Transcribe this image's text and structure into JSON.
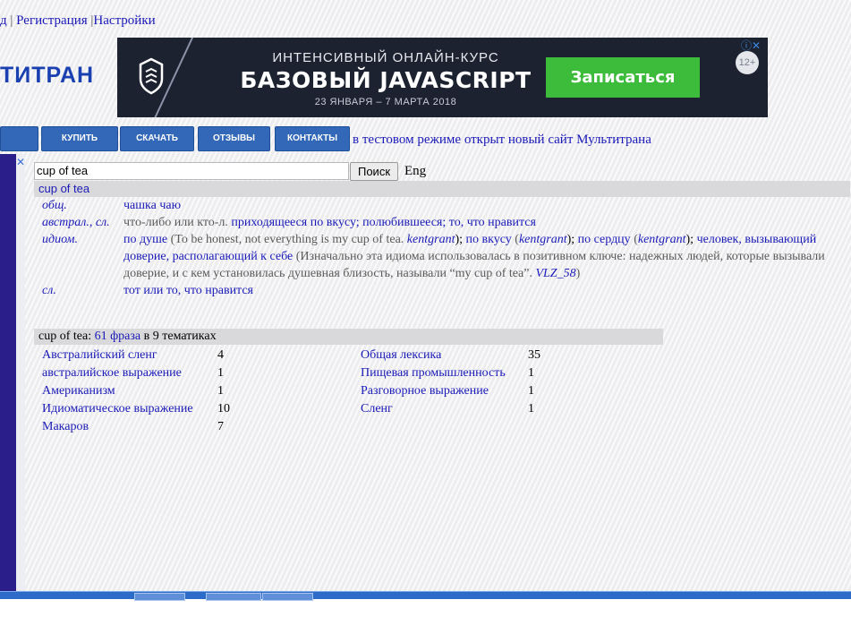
{
  "top_links": {
    "login_fragment": "д",
    "sep1": "|",
    "register": "Регистрация",
    "sep2": "|",
    "settings": "Настройки"
  },
  "logo": {
    "text": "ТИТРАН"
  },
  "banner": {
    "line1": "ИНТЕНСИВНЫЙ ОНЛАЙН-КУРС",
    "line2": "БАЗОВЫЙ JAVASCRIPT",
    "line3": "23 ЯНВАРЯ – 7 МАРТА 2018",
    "cta": "Записаться",
    "age": "12+",
    "adinfo": "ⓘ✕"
  },
  "nav": {
    "buttons": [
      "КУПИТЬ",
      "СКАЧАТЬ",
      "ОТЗЫВЫ",
      "КОНТАКТЫ"
    ],
    "notice": "в тестовом режиме открыт новый сайт Мультитрана"
  },
  "search": {
    "value": "cup of tea",
    "button": "Поиск",
    "lang": "Eng"
  },
  "term": {
    "header": "cup of tea",
    "entries": [
      {
        "subject": "общ.",
        "parts": [
          {
            "t": "чашка чаю",
            "k": "link"
          }
        ]
      },
      {
        "subject": "австрал., сл.",
        "parts": [
          {
            "t": "что-либо или кто-л. ",
            "k": "comment"
          },
          {
            "t": "приходящееся по вкусу; полюбившееся; то, что нравится",
            "k": "link"
          }
        ]
      },
      {
        "subject": "идиом.",
        "parts": [
          {
            "t": "по душе",
            "k": "link"
          },
          {
            "t": " (To be honest, not everything is my cup of tea. ",
            "k": "comment"
          },
          {
            "t": "kentgrant",
            "k": "author"
          },
          {
            "t": "); ",
            "k": "plain"
          },
          {
            "t": "по вкусу",
            "k": "link"
          },
          {
            "t": " (",
            "k": "comment"
          },
          {
            "t": "kentgrant",
            "k": "author"
          },
          {
            "t": "); ",
            "k": "plain"
          },
          {
            "t": "по сердцу",
            "k": "link"
          },
          {
            "t": " (",
            "k": "comment"
          },
          {
            "t": "kentgrant",
            "k": "author"
          },
          {
            "t": "); ",
            "k": "plain"
          },
          {
            "t": "человек, вызывающий доверие, располагающий к себе",
            "k": "link"
          },
          {
            "t": " (Изначально эта идиома использовалась в позитивном ключе: надежных людей, которые вызывали доверие, и с кем установилась душевная близость, называли “my cup of tea”. ",
            "k": "comment"
          },
          {
            "t": "VLZ_58",
            "k": "author"
          },
          {
            "t": ")",
            "k": "comment"
          }
        ]
      },
      {
        "subject": "сл.",
        "parts": [
          {
            "t": "тот или то, что нравится",
            "k": "link"
          }
        ]
      }
    ]
  },
  "phrases": {
    "prefix": "cup of tea: ",
    "count_link": "61 фраза",
    "suffix": " в 9 тематиках",
    "left": [
      {
        "label": "Австралийский сленг",
        "count": "4"
      },
      {
        "label": "австралийское выражение",
        "count": "1"
      },
      {
        "label": "Американизм",
        "count": "1"
      },
      {
        "label": "Идиоматическое выражение",
        "count": "10"
      },
      {
        "label": "Макаров",
        "count": "7"
      }
    ],
    "right": [
      {
        "label": "Общая лексика",
        "count": "35"
      },
      {
        "label": "Пищевая промышленность",
        "count": "1"
      },
      {
        "label": "Разговорное выражение",
        "count": "1"
      },
      {
        "label": "Сленг",
        "count": "1"
      }
    ]
  },
  "colors": {
    "link": "#1a1ab8",
    "nav_button": "#3368b8",
    "cta": "#3dbb3a",
    "banner_bg": "#1d2230",
    "header_bar": "#d9d9db",
    "taskbar": "#2d6bc9"
  },
  "icons": {
    "ad_close": "✕",
    "banner_logo": "shield-logo-icon"
  }
}
